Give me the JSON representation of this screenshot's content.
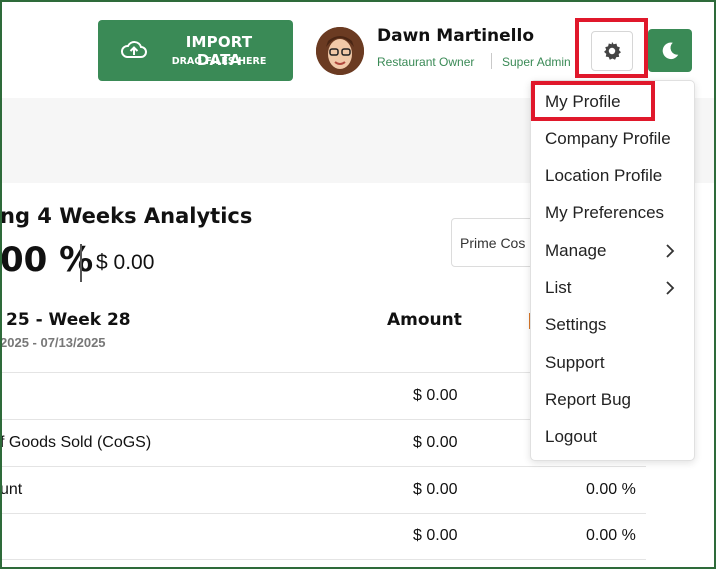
{
  "header": {
    "import_title": "IMPORT DATA",
    "import_subtitle": "DRAG FILES HERE",
    "user_name": "Dawn Martinello",
    "user_role": "Restaurant Owner",
    "user_admin": "Super Admin"
  },
  "analytics": {
    "title": "ng 4 Weeks Analytics",
    "percent": "00 %",
    "amount": "$ 0.00",
    "select_value": "Prime Cos",
    "week_range": "25 - Week 28",
    "date_range": "2025 - 07/13/2025",
    "amount_header": "Amount"
  },
  "rows": [
    {
      "label": "",
      "amount": "$ 0.00",
      "pct": ""
    },
    {
      "label": "f Goods Sold (CoGS)",
      "amount": "$ 0.00",
      "pct": ""
    },
    {
      "label": "unt",
      "amount": "$ 0.00",
      "pct": "0.00 %"
    },
    {
      "label": "",
      "amount": "$ 0.00",
      "pct": "0.00 %"
    }
  ],
  "menu": {
    "items": [
      {
        "label": "My Profile"
      },
      {
        "label": "Company Profile"
      },
      {
        "label": "Location Profile"
      },
      {
        "label": "My Preferences"
      },
      {
        "label": "Manage"
      },
      {
        "label": "List"
      },
      {
        "label": "Settings"
      },
      {
        "label": "Support"
      },
      {
        "label": "Report Bug"
      },
      {
        "label": "Logout"
      }
    ]
  },
  "icons": {
    "cloud": "cloud-upload-icon",
    "gear": "gear-icon",
    "theme": "moon-icon",
    "chevron": "chevron-right-icon"
  },
  "colors": {
    "brand_green": "#3a8a56",
    "highlight_red": "#e0182b",
    "frame_green": "#2e6b3a"
  }
}
